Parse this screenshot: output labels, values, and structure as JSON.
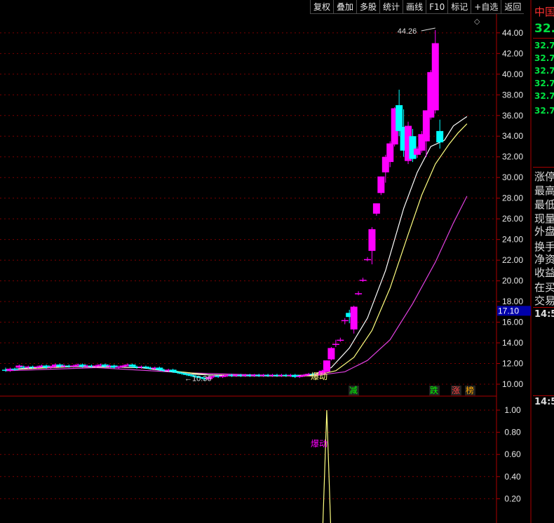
{
  "toolbar": {
    "buttons": [
      "复权",
      "叠加",
      "多股",
      "统计",
      "画线",
      "F10",
      "标记",
      "+自选",
      "返回"
    ]
  },
  "side_panel": {
    "title": "中国",
    "price": "32.",
    "quotes": [
      "32.7",
      "32.7",
      "32.7",
      "32.7",
      "32.7",
      "32.7"
    ],
    "fields": [
      "涨停",
      "最高",
      "最低",
      "现量",
      "外盘",
      "换手",
      "净资",
      "收益",
      "在买",
      "交易"
    ],
    "time1": "14:5",
    "time2": "14:5"
  },
  "colors": {
    "up": "#ff00ff",
    "down": "#00ffff",
    "ma_short": "#ffffff",
    "ma_mid": "#ffff80",
    "ma_long": "#e040e0",
    "grid": "#7a0000",
    "axis": "#aa0000",
    "signal": "#ffff80"
  },
  "chart_data": [
    {
      "type": "candlestick",
      "y_axis": {
        "ylim": [
          10,
          44
        ],
        "ticks": [
          10.0,
          12.0,
          14.0,
          16.0,
          18.0,
          20.0,
          22.0,
          24.0,
          26.0,
          28.0,
          30.0,
          32.0,
          34.0,
          36.0,
          38.0,
          40.0,
          42.0,
          44.0
        ]
      },
      "current_price_label": "17.10",
      "annotations": {
        "high": "44.26",
        "low": "10.36",
        "low_arrow": "←10.36"
      },
      "signal_labels": [
        "爆动",
        "减",
        "跌",
        "涨",
        "榜"
      ],
      "candles": [
        [
          11.4,
          11.3,
          11.6,
          11.2
        ],
        [
          11.3,
          11.5,
          11.6,
          11.2
        ],
        [
          11.5,
          11.4,
          11.6,
          11.3
        ],
        [
          11.6,
          11.8,
          11.9,
          11.5
        ],
        [
          11.7,
          11.6,
          11.8,
          11.5
        ],
        [
          11.6,
          11.7,
          11.8,
          11.5
        ],
        [
          11.7,
          11.6,
          11.8,
          11.5
        ],
        [
          11.6,
          11.7,
          11.8,
          11.5
        ],
        [
          11.7,
          11.8,
          11.9,
          11.6
        ],
        [
          11.8,
          11.6,
          11.9,
          11.5
        ],
        [
          11.6,
          11.7,
          11.8,
          11.5
        ],
        [
          11.7,
          11.9,
          12.0,
          11.6
        ],
        [
          11.9,
          11.7,
          12.0,
          11.6
        ],
        [
          11.7,
          11.8,
          11.9,
          11.6
        ],
        [
          11.8,
          11.7,
          11.9,
          11.6
        ],
        [
          11.7,
          11.8,
          11.9,
          11.6
        ],
        [
          11.8,
          11.9,
          12.0,
          11.7
        ],
        [
          11.9,
          11.7,
          12.0,
          11.6
        ],
        [
          11.7,
          11.8,
          11.9,
          11.6
        ],
        [
          11.8,
          11.7,
          11.9,
          11.6
        ],
        [
          11.7,
          11.8,
          11.9,
          11.6
        ],
        [
          11.8,
          11.9,
          12.0,
          11.7
        ],
        [
          11.9,
          11.7,
          12.0,
          11.6
        ],
        [
          11.7,
          11.8,
          11.9,
          11.6
        ],
        [
          11.8,
          11.6,
          11.9,
          11.5
        ],
        [
          11.6,
          11.7,
          11.8,
          11.5
        ],
        [
          11.7,
          11.8,
          11.9,
          11.6
        ],
        [
          11.8,
          11.9,
          12.0,
          11.7
        ],
        [
          11.9,
          11.7,
          12.0,
          11.6
        ],
        [
          11.7,
          11.6,
          11.8,
          11.5
        ],
        [
          11.6,
          11.7,
          11.8,
          11.5
        ],
        [
          11.7,
          11.6,
          11.8,
          11.5
        ],
        [
          11.6,
          11.5,
          11.7,
          11.4
        ],
        [
          11.5,
          11.6,
          11.7,
          11.4
        ],
        [
          11.6,
          11.4,
          11.7,
          11.3
        ],
        [
          11.4,
          11.3,
          11.5,
          11.2
        ],
        [
          11.3,
          11.4,
          11.5,
          11.2
        ],
        [
          11.4,
          11.2,
          11.5,
          11.1
        ],
        [
          11.2,
          11.1,
          11.3,
          11.0
        ],
        [
          11.1,
          11.0,
          11.2,
          10.9
        ],
        [
          11.0,
          10.9,
          11.1,
          10.8
        ],
        [
          10.9,
          10.8,
          11.0,
          10.7
        ],
        [
          10.8,
          10.7,
          10.9,
          10.6
        ],
        [
          10.7,
          10.6,
          10.8,
          10.5
        ],
        [
          10.6,
          10.5,
          10.7,
          10.36
        ],
        [
          10.5,
          10.7,
          10.8,
          10.4
        ],
        [
          10.7,
          10.8,
          10.9,
          10.6
        ],
        [
          10.8,
          10.7,
          10.9,
          10.6
        ],
        [
          10.7,
          10.8,
          10.9,
          10.6
        ],
        [
          10.8,
          10.9,
          11.0,
          10.7
        ],
        [
          10.9,
          10.8,
          11.0,
          10.7
        ],
        [
          10.8,
          10.9,
          11.0,
          10.7
        ],
        [
          10.9,
          10.8,
          11.0,
          10.7
        ],
        [
          10.8,
          10.9,
          11.0,
          10.7
        ],
        [
          10.9,
          10.8,
          11.0,
          10.7
        ],
        [
          10.8,
          10.9,
          11.0,
          10.7
        ],
        [
          10.9,
          10.8,
          11.0,
          10.7
        ],
        [
          10.8,
          10.9,
          11.0,
          10.7
        ],
        [
          10.9,
          10.8,
          11.0,
          10.7
        ],
        [
          10.8,
          10.9,
          11.0,
          10.7
        ],
        [
          10.9,
          10.8,
          11.0,
          10.7
        ],
        [
          10.8,
          10.9,
          11.0,
          10.7
        ],
        [
          10.9,
          10.8,
          11.0,
          10.7
        ],
        [
          10.8,
          10.9,
          11.0,
          10.7
        ],
        [
          10.9,
          10.7,
          11.0,
          10.6
        ],
        [
          10.7,
          10.8,
          10.9,
          10.6
        ],
        [
          10.8,
          10.9,
          11.0,
          10.7
        ],
        [
          10.9,
          11.0,
          11.1,
          10.8
        ],
        [
          11.0,
          10.9,
          11.1,
          10.8
        ],
        [
          10.9,
          11.0,
          11.1,
          10.8
        ],
        [
          11.0,
          11.3,
          11.4,
          10.9
        ],
        [
          11.2,
          12.3,
          12.3,
          11.1
        ],
        [
          12.4,
          13.5,
          13.6,
          12.3
        ],
        [
          13.9,
          13.9,
          14.3,
          13.6
        ],
        [
          14.3,
          14.3,
          14.5,
          14.1
        ],
        [
          16.2,
          16.2,
          16.4,
          15.8
        ],
        [
          16.9,
          16.5,
          17.2,
          15.9
        ],
        [
          15.3,
          17.5,
          17.6,
          14.9
        ],
        [
          18.8,
          18.8,
          19.0,
          18.6
        ],
        [
          20.1,
          20.1,
          20.3,
          19.9
        ],
        [
          22.1,
          22.1,
          22.3,
          21.9
        ],
        [
          22.9,
          25.0,
          25.2,
          21.6
        ],
        [
          26.5,
          27.5,
          27.5,
          26.3
        ],
        [
          28.5,
          30.1,
          30.1,
          28.3
        ],
        [
          30.5,
          32.0,
          32.2,
          29.5
        ],
        [
          31.5,
          33.3,
          33.5,
          31.0
        ],
        [
          33.2,
          36.7,
          36.8,
          33.0
        ],
        [
          37.0,
          34.5,
          38.5,
          34.0
        ],
        [
          34.9,
          32.6,
          36.6,
          32.0
        ],
        [
          31.6,
          35.0,
          35.4,
          31.3
        ],
        [
          34.0,
          31.8,
          34.7,
          31.5
        ],
        [
          32.2,
          32.8,
          33.0,
          31.9
        ],
        [
          32.6,
          34.2,
          34.5,
          32.4
        ],
        [
          33.5,
          36.5,
          36.5,
          32.0
        ],
        [
          35.8,
          40.2,
          40.4,
          35.6
        ],
        [
          36.5,
          43.0,
          44.26,
          36.2
        ],
        [
          34.5,
          33.4,
          35.6,
          32.8
        ]
      ],
      "ma_short": [
        [
          0,
          11.4
        ],
        [
          10,
          11.7
        ],
        [
          20,
          11.7
        ],
        [
          30,
          11.6
        ],
        [
          40,
          11.0
        ],
        [
          50,
          10.8
        ],
        [
          60,
          10.8
        ],
        [
          68,
          10.9
        ],
        [
          72,
          11.6
        ],
        [
          76,
          13.5
        ],
        [
          80,
          16.4
        ],
        [
          84,
          21.0
        ],
        [
          88,
          27.0
        ],
        [
          91,
          30.5
        ],
        [
          94,
          33.0
        ],
        [
          97,
          33.6
        ],
        [
          99,
          35.0
        ],
        [
          101,
          35.6
        ],
        [
          102,
          35.9
        ]
      ],
      "ma_mid": [
        [
          0,
          11.4
        ],
        [
          15,
          11.7
        ],
        [
          30,
          11.6
        ],
        [
          45,
          10.9
        ],
        [
          60,
          10.8
        ],
        [
          68,
          10.8
        ],
        [
          73,
          11.3
        ],
        [
          77,
          12.6
        ],
        [
          81,
          15.2
        ],
        [
          85,
          19.3
        ],
        [
          89,
          24.5
        ],
        [
          92,
          28.3
        ],
        [
          95,
          31.3
        ],
        [
          98,
          33.2
        ],
        [
          100,
          34.3
        ],
        [
          102,
          35.2
        ]
      ],
      "ma_long": [
        [
          0,
          11.3
        ],
        [
          20,
          11.6
        ],
        [
          40,
          11.1
        ],
        [
          55,
          10.9
        ],
        [
          68,
          10.8
        ],
        [
          75,
          11.2
        ],
        [
          80,
          12.3
        ],
        [
          85,
          14.3
        ],
        [
          90,
          17.8
        ],
        [
          95,
          21.8
        ],
        [
          99,
          25.6
        ],
        [
          102,
          28.2
        ]
      ]
    },
    {
      "type": "line",
      "y_axis": {
        "ylim": [
          0,
          1.08
        ],
        "ticks": [
          0.2,
          0.4,
          0.6,
          0.8,
          1.0
        ]
      },
      "label": "爆动",
      "points": [
        [
          70,
          -0.2
        ],
        [
          71,
          1.0
        ],
        [
          72,
          -0.2
        ]
      ]
    }
  ]
}
